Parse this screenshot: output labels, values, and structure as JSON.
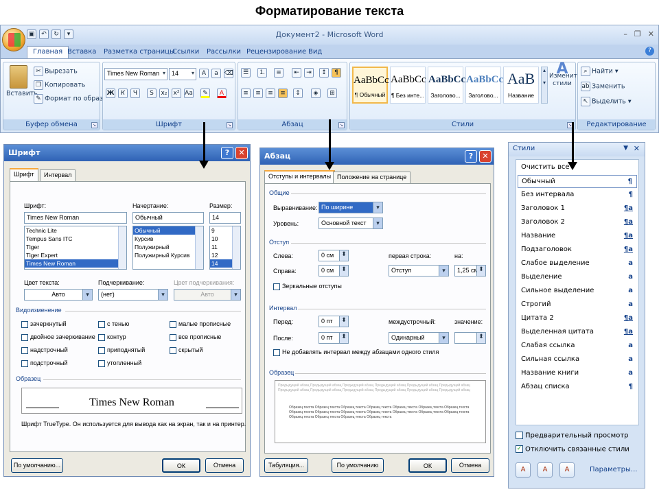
{
  "slide_title": "Форматирование текста",
  "word": {
    "title": "Документ2 - Microsoft Word",
    "tabs": [
      "Главная",
      "Вставка",
      "Разметка страницы",
      "Ссылки",
      "Рассылки",
      "Рецензирование",
      "Вид"
    ],
    "clipboard": {
      "paste": "Вставить",
      "cut": "Вырезать",
      "copy": "Копировать",
      "format_painter": "Формат по образцу",
      "label": "Буфер обмена"
    },
    "font": {
      "name": "Times New Roman",
      "size": "14",
      "label": "Шрифт",
      "bold": "Ж",
      "italic": "К",
      "underline": "Ч"
    },
    "paragraph": {
      "label": "Абзац"
    },
    "styles": {
      "tiles": [
        {
          "sample": "AaBbCc",
          "label": "¶ Обычный"
        },
        {
          "sample": "AaBbCc",
          "label": "¶ Без инте..."
        },
        {
          "sample": "AaBbCc",
          "label": "Заголово..."
        },
        {
          "sample": "AaBbCc",
          "label": "Заголово..."
        },
        {
          "sample": "AaB",
          "label": "Название"
        }
      ],
      "change": "Изменить стили",
      "label": "Стили"
    },
    "editing": {
      "find": "Найти",
      "replace": "Заменить",
      "select": "Выделить",
      "label": "Редактирование"
    }
  },
  "font_dialog": {
    "title": "Шрифт",
    "tabs": [
      "Шрифт",
      "Интервал"
    ],
    "font_label": "Шрифт:",
    "font_value": "Times New Roman",
    "font_list": [
      "Technic Lite",
      "Tempus Sans ITC",
      "Tiger",
      "Tiger Expert",
      "Times New Roman"
    ],
    "style_label": "Начертание:",
    "style_value": "Обычный",
    "style_list": [
      "Обычный",
      "Курсив",
      "Полужирный",
      "Полужирный Курсив"
    ],
    "size_label": "Размер:",
    "size_value": "14",
    "size_list": [
      "9",
      "10",
      "11",
      "12",
      "14"
    ],
    "color_label": "Цвет текста:",
    "color_value": "Авто",
    "underline_label": "Подчеркивание:",
    "underline_value": "(нет)",
    "underline_color_label": "Цвет подчеркивания:",
    "underline_color_value": "Авто",
    "effects_label": "Видоизменение",
    "effects": [
      "зачеркнутый",
      "двойное зачеркивание",
      "надстрочный",
      "подстрочный",
      "с тенью",
      "контур",
      "приподнятый",
      "утопленный",
      "малые прописные",
      "все прописные",
      "скрытый"
    ],
    "preview_label": "Образец",
    "preview_text": "Times New Roman",
    "description": "Шрифт TrueType. Он используется для вывода как на экран, так и на принтер.",
    "default_btn": "По умолчанию...",
    "ok": "ОК",
    "cancel": "Отмена"
  },
  "para_dialog": {
    "title": "Абзац",
    "tabs": [
      "Отступы и интервалы",
      "Положение на странице"
    ],
    "general_label": "Общие",
    "align_label": "Выравнивание:",
    "align_value": "По ширине",
    "level_label": "Уровень:",
    "level_value": "Основной текст",
    "indent_label": "Отступ",
    "left_label": "Слева:",
    "left_value": "0 см",
    "right_label": "Справа:",
    "right_value": "0 см",
    "first_line_label": "первая строка:",
    "first_line_value": "Отступ",
    "on_label": "на:",
    "on_value": "1,25 см",
    "mirror_label": "Зеркальные отступы",
    "spacing_label": "Интервал",
    "before_label": "Перед:",
    "before_value": "0 пт",
    "after_label": "После:",
    "after_value": "0 пт",
    "line_label": "междустрочный:",
    "line_value": "Одинарный",
    "value_label": "значение:",
    "value_value": "",
    "no_space_label": "Не добавлять интервал между абзацами одного стиля",
    "preview_label": "Образец",
    "preview_prev": "Предыдущий абзац Предыдущий абзац Предыдущий абзац Предыдущий абзац Предыдущий абзац Предыдущий абзац Предыдущий абзац Предыдущий абзац Предыдущий абзац Предыдущий абзац Предыдущий абзац Предыдущий абзац",
    "preview_body": "Образец текста Образец текста Образец текста Образец текста Образец текста Образец текста Образец текста Образец текста Образец текста Образец текста Образец текста Образец текста Образец текста Образец текста Образец текста Образец текста Образец текста Образец текста",
    "tabs_btn": "Табуляция...",
    "default_btn": "По умолчанию",
    "ok": "ОК",
    "cancel": "Отмена"
  },
  "styles_pane": {
    "title": "Стили",
    "items": [
      {
        "name": "Очистить все",
        "mark": ""
      },
      {
        "name": "Обычный",
        "mark": "¶"
      },
      {
        "name": "Без интервала",
        "mark": "¶"
      },
      {
        "name": "Заголовок 1",
        "mark": "¶a"
      },
      {
        "name": "Заголовок 2",
        "mark": "¶a"
      },
      {
        "name": "Название",
        "mark": "¶a"
      },
      {
        "name": "Подзаголовок",
        "mark": "¶a"
      },
      {
        "name": "Слабое выделение",
        "mark": "a"
      },
      {
        "name": "Выделение",
        "mark": "a"
      },
      {
        "name": "Сильное выделение",
        "mark": "a"
      },
      {
        "name": "Строгий",
        "mark": "a"
      },
      {
        "name": "Цитата 2",
        "mark": "¶a"
      },
      {
        "name": "Выделенная цитата",
        "mark": "¶a"
      },
      {
        "name": "Слабая ссылка",
        "mark": "a"
      },
      {
        "name": "Сильная ссылка",
        "mark": "a"
      },
      {
        "name": "Название книги",
        "mark": "a"
      },
      {
        "name": "Абзац списка",
        "mark": "¶"
      }
    ],
    "preview_chk": "Предварительный просмотр",
    "linked_chk": "Отключить связанные стили",
    "params": "Параметры..."
  }
}
